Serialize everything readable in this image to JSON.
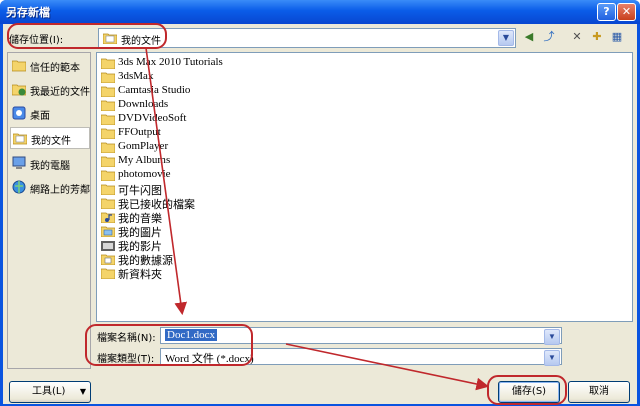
{
  "window": {
    "title": "另存新檔"
  },
  "titlebar": {
    "help": "?",
    "close": "✕"
  },
  "save_in": {
    "label": "儲存位置(I):",
    "value": "我的文件"
  },
  "toolbar": {
    "back": "◀",
    "up": "⤴",
    "delete": "✕",
    "new_folder": "✚",
    "views": "▦"
  },
  "places": [
    {
      "label": "信任的範本",
      "icon": "folder-icon"
    },
    {
      "label": "我最近的文件",
      "icon": "recent-documents-icon"
    },
    {
      "label": "桌面",
      "icon": "desktop-icon"
    },
    {
      "label": "我的文件",
      "icon": "my-documents-icon",
      "selected": true
    },
    {
      "label": "我的電腦",
      "icon": "my-computer-icon"
    },
    {
      "label": "網路上的芳鄰",
      "icon": "network-places-icon"
    }
  ],
  "files": [
    {
      "name": "3ds Max 2010 Tutorials",
      "icon": "folder-icon"
    },
    {
      "name": "3dsMax",
      "icon": "folder-icon"
    },
    {
      "name": "Camtasia Studio",
      "icon": "folder-icon"
    },
    {
      "name": "Downloads",
      "icon": "folder-icon"
    },
    {
      "name": "DVDVideoSoft",
      "icon": "folder-icon"
    },
    {
      "name": "FFOutput",
      "icon": "folder-icon"
    },
    {
      "name": "GomPlayer",
      "icon": "folder-icon"
    },
    {
      "name": "My Albums",
      "icon": "folder-icon"
    },
    {
      "name": "photomovie",
      "icon": "folder-icon"
    },
    {
      "name": "可牛闪图",
      "icon": "folder-icon"
    },
    {
      "name": "我已接收的檔案",
      "icon": "folder-icon"
    },
    {
      "name": "我的音樂",
      "icon": "music-folder-icon"
    },
    {
      "name": "我的圖片",
      "icon": "pictures-folder-icon"
    },
    {
      "name": "我的影片",
      "icon": "video-folder-icon"
    },
    {
      "name": "我的數據源",
      "icon": "data-sources-folder-icon"
    },
    {
      "name": "新資料夾",
      "icon": "folder-icon"
    }
  ],
  "filename": {
    "label": "檔案名稱(N):",
    "value": "Doc1.docx"
  },
  "filetype": {
    "label": "檔案類型(T):",
    "value": "Word 文件 (*.docx)"
  },
  "buttons": {
    "tools": "工具(L)",
    "save": "儲存(S)",
    "cancel": "取消"
  },
  "colors": {
    "title_bar": "#0a5ce8",
    "dialog_bg": "#ece9d8",
    "annotation": "#c0282c",
    "selection": "#316ac5"
  }
}
